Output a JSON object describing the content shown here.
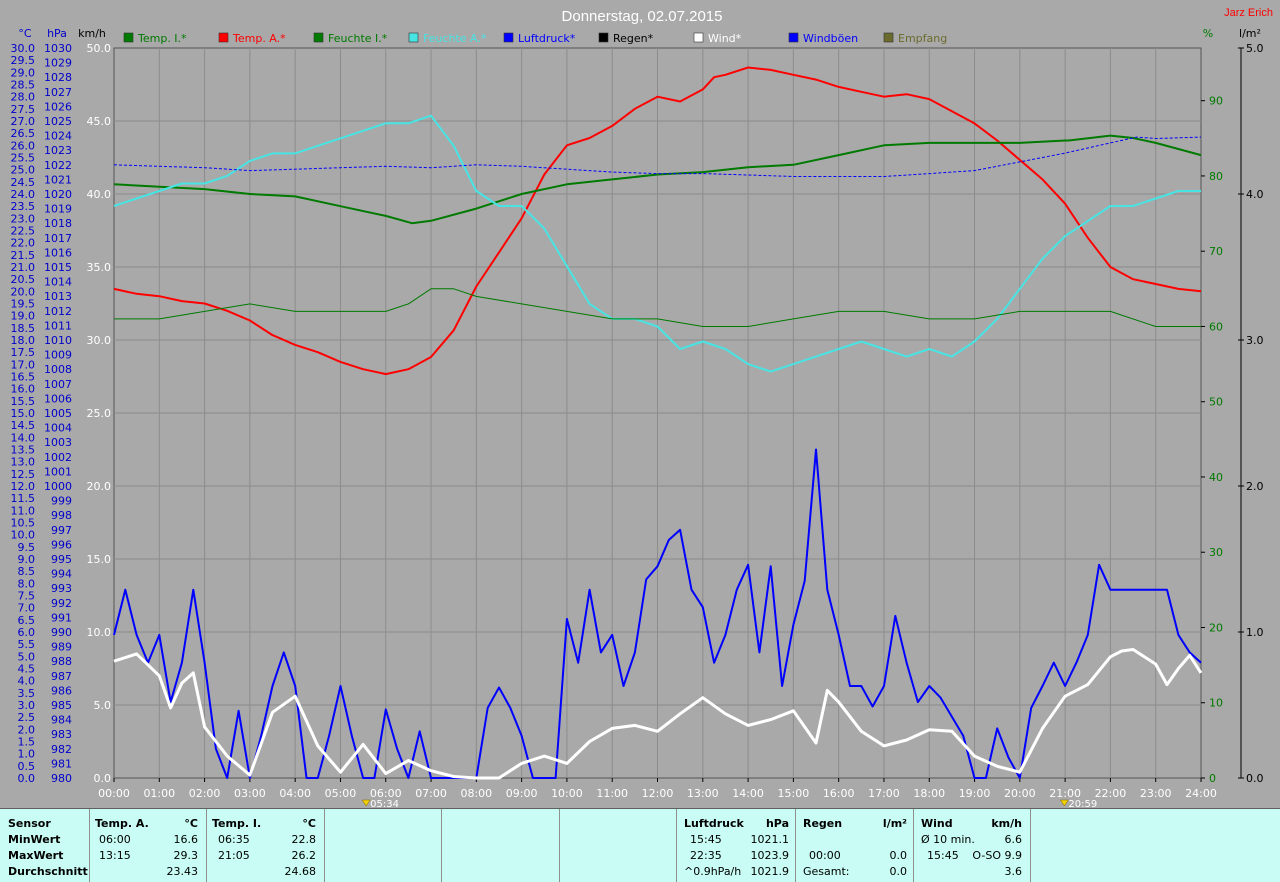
{
  "header": {
    "title": "Donnerstag, 02.07.2015",
    "station": "Jarz Erich",
    "unit_celsius": "°C",
    "unit_hpa": "hPa",
    "unit_kmh": "km/h",
    "unit_percent": "%",
    "unit_lm2": "l/m²"
  },
  "legend": [
    {
      "label": "Temp. I.*",
      "color": "#007a00"
    },
    {
      "label": "Temp. A.*",
      "color": "#ff0000"
    },
    {
      "label": "Feuchte I.*",
      "color": "#007a00"
    },
    {
      "label": "Feuchte A.*",
      "color": "#48e4e4"
    },
    {
      "label": "Luftdruck*",
      "color": "#0000ff"
    },
    {
      "label": "Regen*",
      "color": "#000000"
    },
    {
      "label": "Wind*",
      "color": "#ffffff"
    },
    {
      "label": "Windböen",
      "color": "#0000ff"
    },
    {
      "label": "Empfang",
      "color": "#6b6b2e"
    }
  ],
  "markers": {
    "sunrise": "05:34",
    "sunset": "20:59"
  },
  "chart_data": {
    "type": "line",
    "x_unit": "hours",
    "x_ticks": [
      "00:00",
      "01:00",
      "02:00",
      "03:00",
      "04:00",
      "05:00",
      "06:00",
      "07:00",
      "08:00",
      "09:00",
      "10:00",
      "11:00",
      "12:00",
      "13:00",
      "14:00",
      "15:00",
      "16:00",
      "17:00",
      "18:00",
      "19:00",
      "20:00",
      "21:00",
      "22:00",
      "23:00",
      "24:00"
    ],
    "axes": {
      "temp_c": {
        "range": [
          0,
          30
        ],
        "step": 0.5
      },
      "pressure_hpa": {
        "range": [
          980,
          1030
        ],
        "step": 1
      },
      "wind_kmh": {
        "range": [
          0,
          50
        ],
        "labels": [
          "0.0",
          "5.0",
          "10.0",
          "15.0",
          "20.0",
          "25.0",
          "30.0",
          "35.0",
          "40.0",
          "45.0",
          "50.0"
        ]
      },
      "humidity_pct": {
        "range": [
          0,
          97
        ],
        "labels": [
          "0",
          "10",
          "20",
          "30",
          "40",
          "50",
          "60",
          "70",
          "80",
          "90"
        ]
      },
      "rain_lm2": {
        "range": [
          0,
          5
        ],
        "labels": [
          "0.0",
          "1.0",
          "2.0",
          "3.0",
          "4.0",
          "5.0"
        ]
      }
    },
    "series": [
      {
        "name": "Temp. A.*",
        "axis": "temp_c",
        "color": "#ff0000",
        "width": 2,
        "x": [
          0,
          0.5,
          1,
          1.5,
          2,
          2.5,
          3,
          3.5,
          4,
          4.5,
          5,
          5.5,
          6,
          6.5,
          7,
          7.5,
          8,
          8.5,
          9,
          9.5,
          10,
          10.5,
          11,
          11.5,
          12,
          12.5,
          13,
          13.25,
          13.5,
          14,
          14.5,
          15,
          15.5,
          16,
          16.5,
          17,
          17.5,
          18,
          18.5,
          19,
          19.5,
          20,
          20.5,
          21,
          21.5,
          22,
          22.5,
          23,
          23.5,
          24
        ],
        "y": [
          20.1,
          19.9,
          19.8,
          19.6,
          19.5,
          19.2,
          18.8,
          18.2,
          17.8,
          17.5,
          17.1,
          16.8,
          16.6,
          16.8,
          17.3,
          18.4,
          20.2,
          21.6,
          23.0,
          24.8,
          26.0,
          26.3,
          26.8,
          27.5,
          28.0,
          27.8,
          28.3,
          28.8,
          28.9,
          29.2,
          29.1,
          28.9,
          28.7,
          28.4,
          28.2,
          28.0,
          28.1,
          27.9,
          27.4,
          26.9,
          26.2,
          25.4,
          24.6,
          23.6,
          22.2,
          21.0,
          20.5,
          20.3,
          20.1,
          20.0
        ]
      },
      {
        "name": "Temp. I.*",
        "axis": "temp_c",
        "color": "#007a00",
        "width": 2,
        "x": [
          0,
          1,
          2,
          3,
          4,
          5,
          6,
          6.58,
          7,
          8,
          9,
          10,
          11,
          12,
          13,
          14,
          15,
          16,
          17,
          18,
          19,
          20,
          21,
          21.08,
          22,
          22.5,
          23,
          24
        ],
        "y": [
          24.4,
          24.3,
          24.2,
          24.0,
          23.9,
          23.5,
          23.1,
          22.8,
          22.9,
          23.4,
          24.0,
          24.4,
          24.6,
          24.8,
          24.9,
          25.1,
          25.2,
          25.6,
          26.0,
          26.1,
          26.1,
          26.1,
          26.2,
          26.2,
          26.4,
          26.3,
          26.1,
          25.6
        ]
      },
      {
        "name": "Feuchte A.*",
        "axis": "humidity_pct",
        "color": "#48e4e4",
        "width": 2,
        "x": [
          0,
          0.5,
          1,
          1.5,
          2,
          2.5,
          3,
          3.5,
          4,
          4.5,
          5,
          5.5,
          6,
          6.5,
          7,
          7.5,
          8,
          8.5,
          9,
          9.5,
          10,
          10.5,
          11,
          11.5,
          12,
          12.5,
          13,
          13.5,
          14,
          14.5,
          15,
          15.5,
          16,
          16.5,
          17,
          17.5,
          18,
          18.5,
          19,
          19.5,
          20,
          20.5,
          21,
          21.5,
          22,
          22.5,
          23,
          23.5,
          24
        ],
        "y": [
          76,
          77,
          78,
          79,
          79,
          80,
          82,
          83,
          83,
          84,
          85,
          86,
          87,
          87,
          88,
          84,
          78,
          76,
          76,
          73,
          68,
          63,
          61,
          61,
          60,
          57,
          58,
          57,
          55,
          54,
          55,
          56,
          57,
          58,
          57,
          56,
          57,
          56,
          58,
          61,
          65,
          69,
          72,
          74,
          76,
          76,
          77,
          78,
          78
        ]
      },
      {
        "name": "Feuchte I.*",
        "axis": "humidity_pct",
        "color": "#007a00",
        "width": 1,
        "x": [
          0,
          1,
          2,
          3,
          4,
          5,
          6,
          6.5,
          7,
          7.5,
          8,
          9,
          10,
          11,
          12,
          13,
          14,
          15,
          16,
          17,
          18,
          19,
          20,
          21,
          22,
          23,
          24
        ],
        "y": [
          61,
          61,
          62,
          63,
          62,
          62,
          62,
          63,
          65,
          65,
          64,
          63,
          62,
          61,
          61,
          60,
          60,
          61,
          62,
          62,
          61,
          61,
          62,
          62,
          62,
          60,
          60
        ]
      },
      {
        "name": "Luftdruck*",
        "axis": "pressure_hpa",
        "color": "#0000ff",
        "width": 1,
        "dash": "3,2",
        "x": [
          0,
          1,
          2,
          3,
          4,
          5,
          6,
          7,
          8,
          9,
          10,
          11,
          12,
          13,
          14,
          15,
          16,
          17,
          18,
          19,
          20,
          21,
          22,
          22.58,
          23,
          24
        ],
        "y": [
          1022.0,
          1021.9,
          1021.8,
          1021.6,
          1021.7,
          1021.8,
          1021.9,
          1021.8,
          1022.0,
          1021.9,
          1021.7,
          1021.5,
          1021.4,
          1021.4,
          1021.3,
          1021.2,
          1021.2,
          1021.2,
          1021.4,
          1021.6,
          1022.2,
          1022.8,
          1023.5,
          1023.9,
          1023.8,
          1023.9
        ]
      },
      {
        "name": "Windböen",
        "axis": "wind_kmh",
        "color": "#0000ff",
        "width": 2,
        "x": [
          0,
          0.25,
          0.5,
          0.75,
          1,
          1.25,
          1.5,
          1.75,
          2,
          2.25,
          2.5,
          2.75,
          3,
          3.25,
          3.5,
          3.75,
          4,
          4.25,
          4.5,
          4.75,
          5,
          5.25,
          5.5,
          5.75,
          6,
          6.25,
          6.5,
          6.75,
          7,
          7.25,
          7.5,
          7.75,
          8,
          8.25,
          8.5,
          8.75,
          9,
          9.25,
          9.5,
          9.75,
          10,
          10.25,
          10.5,
          10.75,
          11,
          11.25,
          11.5,
          11.75,
          12,
          12.25,
          12.5,
          12.75,
          13,
          13.25,
          13.5,
          13.75,
          14,
          14.25,
          14.5,
          14.75,
          15,
          15.25,
          15.5,
          15.75,
          16,
          16.25,
          16.5,
          16.75,
          17,
          17.25,
          17.5,
          17.75,
          18,
          18.25,
          18.5,
          18.75,
          19,
          19.25,
          19.5,
          19.75,
          20,
          20.25,
          20.5,
          20.75,
          21,
          21.25,
          21.5,
          21.75,
          22,
          22.25,
          22.5,
          22.75,
          23,
          23.25,
          23.5,
          23.75,
          24
        ],
        "y": [
          9.8,
          12.9,
          9.8,
          7.9,
          9.8,
          5.2,
          7.9,
          12.9,
          7.9,
          2.0,
          0.0,
          4.6,
          0.0,
          2.9,
          6.3,
          8.6,
          6.3,
          0.0,
          0.0,
          2.9,
          6.3,
          2.9,
          0.0,
          0.0,
          4.7,
          2.0,
          0.0,
          3.2,
          0.0,
          0.0,
          0.0,
          0.0,
          0.0,
          4.8,
          6.2,
          4.8,
          2.9,
          0.0,
          0.0,
          0.0,
          10.9,
          7.9,
          12.9,
          8.6,
          9.8,
          6.3,
          8.6,
          13.6,
          14.5,
          16.3,
          17.0,
          12.9,
          11.7,
          7.9,
          9.8,
          12.9,
          14.6,
          8.6,
          14.5,
          6.3,
          10.5,
          13.5,
          22.5,
          12.9,
          9.8,
          6.3,
          6.3,
          4.9,
          6.3,
          11.1,
          7.9,
          5.2,
          6.3,
          5.5,
          4.2,
          2.9,
          0.0,
          0.0,
          3.4,
          1.4,
          0.0,
          4.8,
          6.3,
          7.9,
          6.3,
          7.9,
          9.8,
          14.6,
          12.9,
          12.9,
          12.9,
          12.9,
          12.9,
          12.9,
          9.8,
          8.6,
          7.9
        ]
      },
      {
        "name": "Wind*",
        "axis": "wind_kmh",
        "color": "#ffffff",
        "width": 3,
        "x": [
          0,
          0.5,
          1,
          1.25,
          1.5,
          1.75,
          2,
          2.5,
          3,
          3.5,
          4,
          4.5,
          5,
          5.5,
          6,
          6.5,
          7,
          7.5,
          8,
          8.5,
          9,
          9.5,
          10,
          10.5,
          11,
          11.5,
          12,
          12.5,
          13,
          13.5,
          14,
          14.5,
          15,
          15.5,
          15.75,
          16,
          16.5,
          17,
          17.5,
          18,
          18.5,
          19,
          19.5,
          20,
          20.5,
          21,
          21.5,
          22,
          22.25,
          22.5,
          23,
          23.25,
          23.5,
          23.75,
          24
        ],
        "y": [
          8.0,
          8.5,
          7.0,
          4.8,
          6.5,
          7.2,
          3.5,
          1.5,
          0.2,
          4.5,
          5.6,
          2.2,
          0.4,
          2.3,
          0.3,
          1.2,
          0.5,
          0.1,
          0.0,
          0.0,
          1.0,
          1.5,
          1.0,
          2.5,
          3.4,
          3.6,
          3.2,
          4.4,
          5.5,
          4.4,
          3.6,
          4.0,
          4.6,
          2.4,
          6.0,
          5.2,
          3.2,
          2.2,
          2.6,
          3.3,
          3.2,
          1.5,
          0.8,
          0.4,
          3.4,
          5.6,
          6.4,
          8.3,
          8.7,
          8.8,
          7.8,
          6.4,
          7.5,
          8.4,
          7.2
        ]
      }
    ]
  },
  "stats": {
    "sensor": {
      "title": "Sensor",
      "rows": [
        "MinWert",
        "MaxWert",
        "Durchschnitt"
      ]
    },
    "temp_a": {
      "title": "Temp. A.",
      "unit": "°C",
      "rows": [
        {
          "t": "06:00",
          "v": "16.6"
        },
        {
          "t": "13:15",
          "v": "29.3"
        },
        {
          "t": "",
          "v": "23.43"
        }
      ]
    },
    "temp_i": {
      "title": "Temp. I.",
      "unit": "°C",
      "rows": [
        {
          "t": "06:35",
          "v": "22.8"
        },
        {
          "t": "21:05",
          "v": "26.2"
        },
        {
          "t": "",
          "v": "24.68"
        }
      ]
    },
    "druck": {
      "title": "Luftdruck",
      "unit": "hPa",
      "rows": [
        {
          "t": "15:45",
          "v": "1021.1"
        },
        {
          "t": "22:35",
          "v": "1023.9"
        },
        {
          "t": "^0.9hPa/h",
          "v": "1021.9"
        }
      ]
    },
    "regen": {
      "title": "Regen",
      "unit": "l/m²",
      "rows": [
        {
          "t": "",
          "v": ""
        },
        {
          "t": "00:00",
          "v": "0.0"
        },
        {
          "t": "Gesamt:",
          "v": "0.0"
        }
      ]
    },
    "wind": {
      "title": "Wind",
      "unit": "km/h",
      "rows": [
        {
          "t": "Ø 10 min.",
          "v": "6.6"
        },
        {
          "t": "15:45",
          "v": "O-SO 9.9"
        },
        {
          "t": "",
          "v": "3.6"
        }
      ]
    }
  }
}
